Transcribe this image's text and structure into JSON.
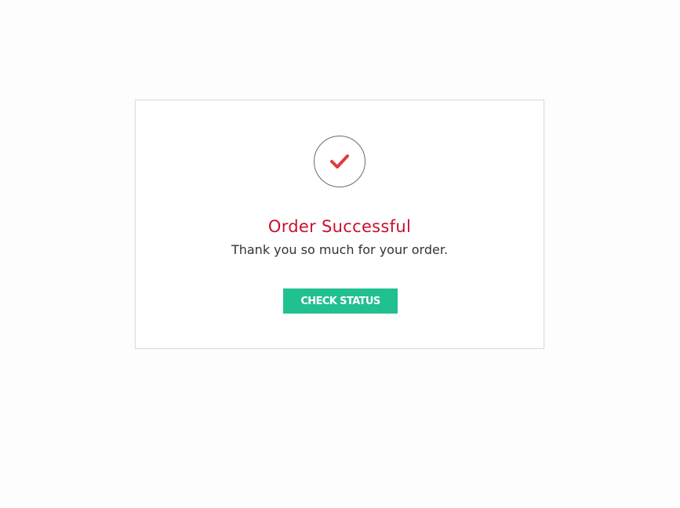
{
  "modal": {
    "icon": "checkmark-icon",
    "title": "Order Successful",
    "message": "Thank you so much for your order.",
    "button_label": "CHECK STATUS"
  },
  "colors": {
    "title": "#c8102e",
    "checkmark": "#e03a3e",
    "button": "#21c08f",
    "circle_border": "#6b6b6b"
  }
}
